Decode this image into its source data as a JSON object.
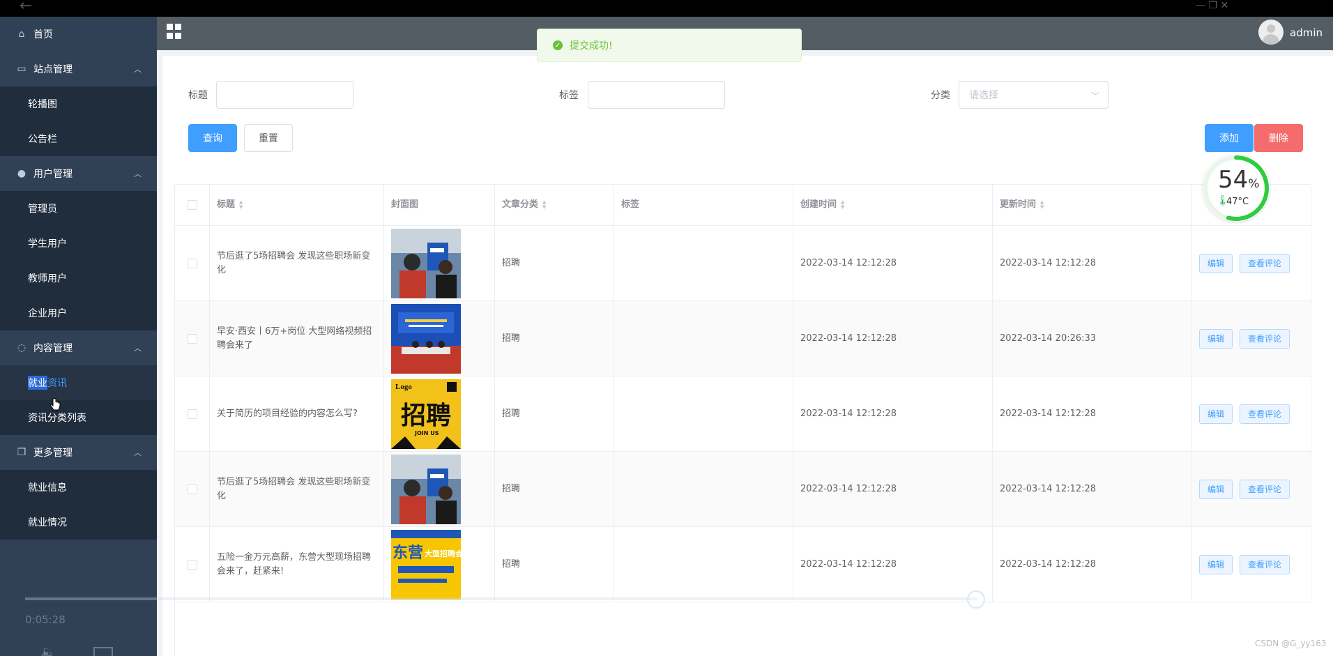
{
  "user": {
    "name": "admin"
  },
  "toast": {
    "message": "提交成功!"
  },
  "sidebar": {
    "groups": [
      {
        "label": "首页",
        "icon": "home-icon"
      },
      {
        "label": "站点管理",
        "icon": "monitor-icon",
        "items": [
          "轮播图",
          "公告栏"
        ]
      },
      {
        "label": "用户管理",
        "icon": "user-icon",
        "items": [
          "管理员",
          "学生用户",
          "教师用户",
          "企业用户"
        ]
      },
      {
        "label": "内容管理",
        "icon": "chat-icon",
        "items": [
          "就业资讯",
          "资讯分类列表"
        ]
      },
      {
        "label": "更多管理",
        "icon": "copy-icon",
        "items": [
          "就业信息",
          "就业情况"
        ]
      }
    ],
    "active_item_part1": "就业",
    "active_item_part2": "资讯"
  },
  "filters": {
    "title_label": "标题",
    "tag_label": "标签",
    "category_label": "分类",
    "category_placeholder": "请选择"
  },
  "buttons": {
    "search": "查询",
    "reset": "重置",
    "add": "添加",
    "delete": "删除",
    "edit": "编辑",
    "view_comments": "查看评论"
  },
  "table": {
    "headers": [
      "标题",
      "封面图",
      "文章分类",
      "标签",
      "创建时间",
      "更新时间",
      ""
    ],
    "rows": [
      {
        "title": "节后逛了5场招聘会 发现这些职场新变化",
        "category": "招聘",
        "tag": "",
        "created": "2022-03-14 12:12:28",
        "updated": "2022-03-14 12:12:28",
        "cover": "crowd"
      },
      {
        "title": "早安·西安丨6万+岗位 大型网络视频招聘会来了",
        "category": "招聘",
        "tag": "",
        "created": "2022-03-14 12:12:28",
        "updated": "2022-03-14 20:26:33",
        "cover": "stage"
      },
      {
        "title": "关于简历的项目经验的内容怎么写?",
        "category": "招聘",
        "tag": "",
        "created": "2022-03-14 12:12:28",
        "updated": "2022-03-14 12:12:28",
        "cover": "yellow"
      },
      {
        "title": "节后逛了5场招聘会 发现这些职场新变化",
        "category": "招聘",
        "tag": "",
        "created": "2022-03-14 12:12:28",
        "updated": "2022-03-14 12:12:28",
        "cover": "crowd"
      },
      {
        "title": "五险一金万元高薪，东营大型现场招聘会来了，赶紧来!",
        "category": "招聘",
        "tag": "",
        "created": "2022-03-14 12:12:28",
        "updated": "2022-03-14 12:12:28",
        "cover": "poster"
      }
    ]
  },
  "cover_texts": {
    "logo": "Logo",
    "zhaopin": "招聘",
    "join": "JOIN US",
    "dongying": "东营",
    "fair": "大型招聘会"
  },
  "cpu_widget": {
    "percent": "54",
    "percent_unit": "%",
    "temp": "47°C",
    "level": 0.54
  },
  "video": {
    "time": "0:05:28"
  },
  "watermark": "CSDN @G_yy163",
  "colors": {
    "sidebar": "#304156",
    "header": "#545c64",
    "primary": "#409eff",
    "danger": "#f56c6c",
    "success": "#67c23a"
  }
}
